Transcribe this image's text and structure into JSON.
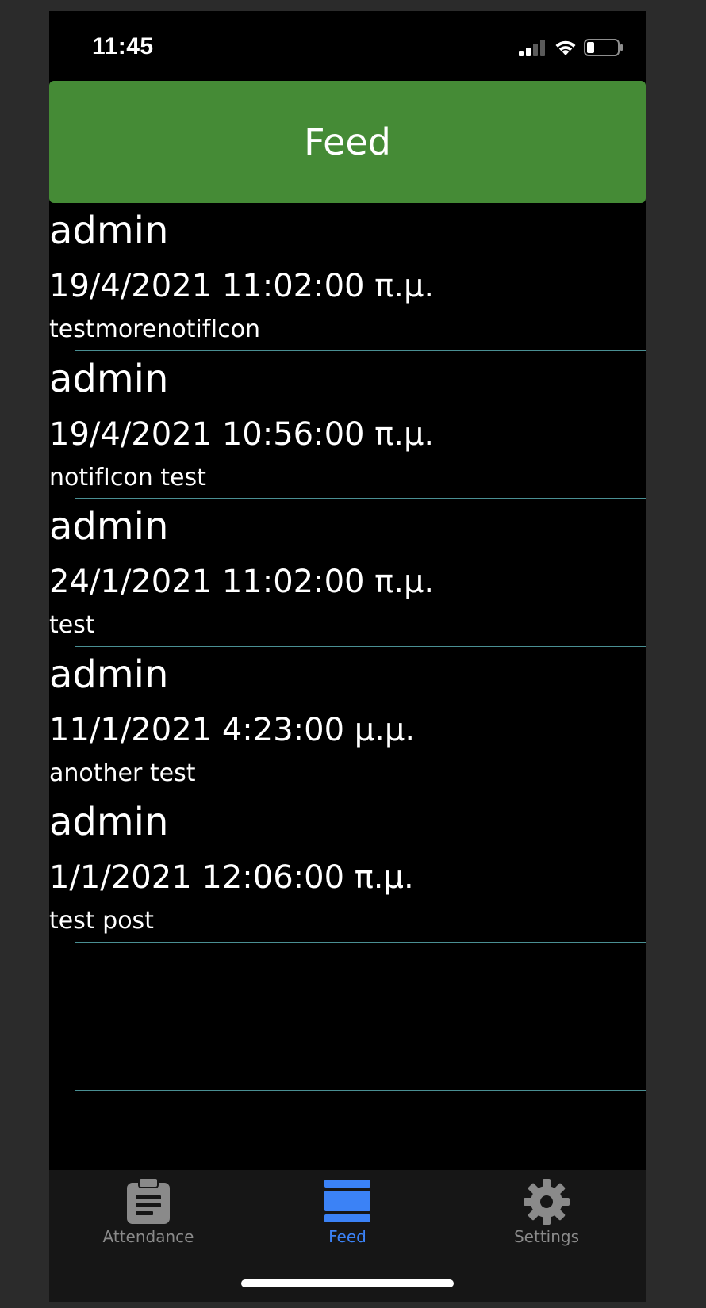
{
  "status_bar": {
    "time": "11:45"
  },
  "header": {
    "title": "Feed",
    "color": "#458b36"
  },
  "feed": {
    "items": [
      {
        "author": "admin",
        "date": "19/4/2021 11:02:00 π.μ.",
        "message": "testmorenotifIcon"
      },
      {
        "author": "admin",
        "date": "19/4/2021 10:56:00 π.μ.",
        "message": "notifIcon test"
      },
      {
        "author": "admin",
        "date": "24/1/2021 11:02:00 π.μ.",
        "message": "test"
      },
      {
        "author": "admin",
        "date": "11/1/2021 4:23:00 μ.μ.",
        "message": "another test"
      },
      {
        "author": "admin",
        "date": "1/1/2021 12:06:00 π.μ.",
        "message": "test post"
      }
    ]
  },
  "tab_bar": {
    "tabs": [
      {
        "label": "Attendance",
        "icon": "clipboard-icon",
        "active": false
      },
      {
        "label": "Feed",
        "icon": "feed-icon",
        "active": true
      },
      {
        "label": "Settings",
        "icon": "gear-icon",
        "active": false
      }
    ],
    "active_color": "#3b82f6",
    "inactive_color": "#8a8a8a"
  }
}
